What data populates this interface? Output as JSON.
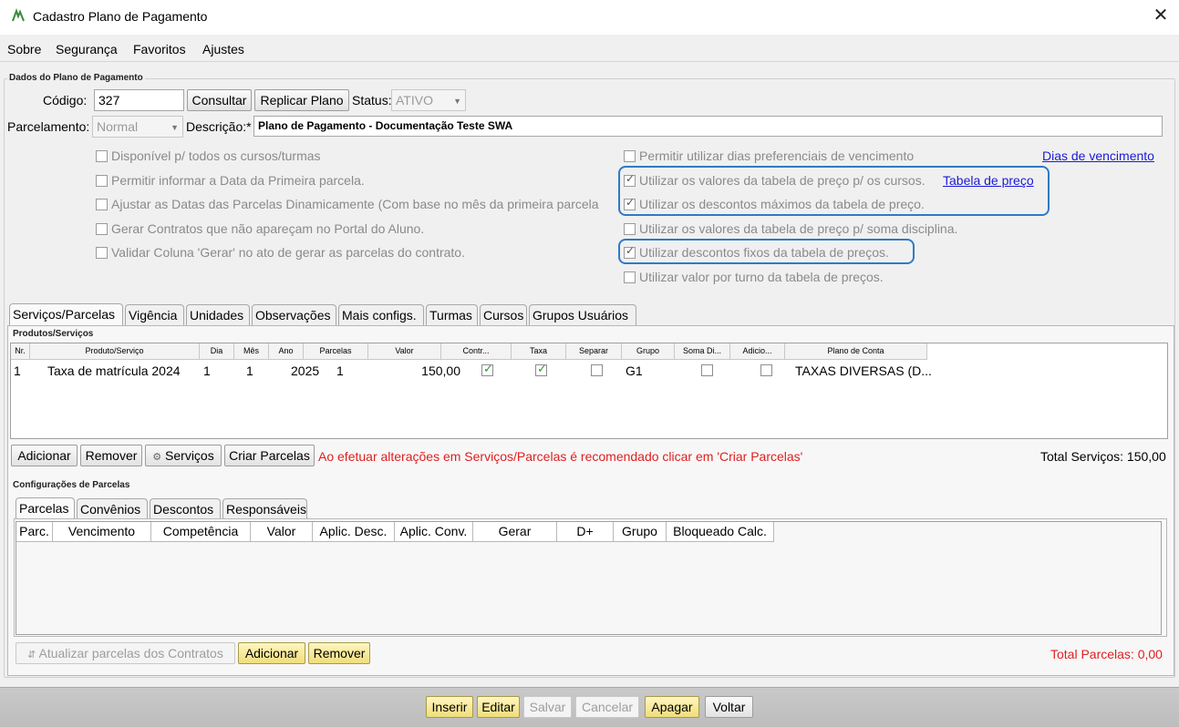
{
  "window": {
    "title": "Cadastro Plano de Pagamento"
  },
  "menu": {
    "items": [
      "Sobre",
      "Segurança",
      "Favoritos",
      "Ajustes"
    ]
  },
  "dados": {
    "legend": "Dados do Plano de Pagamento",
    "codigo_label": "Código:",
    "codigo_value": "327",
    "consultar_label": "Consultar",
    "replicar_label": "Replicar Plano",
    "status_label": "Status:",
    "status_value": "ATIVO",
    "parcelamento_label": "Parcelamento:",
    "parcelamento_value": "Normal",
    "descricao_label": "Descrição:*",
    "descricao_value": "Plano de Pagamento - Documentação Teste SWA"
  },
  "options_left": [
    {
      "label": "Disponível p/ todos os cursos/turmas",
      "checked": false
    },
    {
      "label": "Permitir informar a Data da Primeira parcela.",
      "checked": false
    },
    {
      "label": "Ajustar as Datas das Parcelas Dinamicamente (Com base no mês da primeira parcela",
      "checked": false
    },
    {
      "label": "Gerar Contratos que não apareçam no Portal do Aluno.",
      "checked": false
    },
    {
      "label": "Validar Coluna 'Gerar' no ato de gerar as parcelas do contrato.",
      "checked": false
    }
  ],
  "options_right": [
    {
      "label": "Permitir utilizar dias preferenciais de vencimento",
      "checked": false
    },
    {
      "label": "Utilizar os valores da tabela de preço p/ os cursos.",
      "checked": true
    },
    {
      "label": "Utilizar os descontos máximos da tabela de preço.",
      "checked": true
    },
    {
      "label": "Utilizar os valores da tabela de preço p/ soma disciplina.",
      "checked": false
    },
    {
      "label": "Utilizar descontos fixos da tabela de preços.",
      "checked": true
    },
    {
      "label": "Utilizar valor por turno da tabela de preços.",
      "checked": false
    }
  ],
  "links": {
    "dias": "Dias de vencimento",
    "tabela": "Tabela de preço"
  },
  "main_tabs": [
    "Serviços/Parcelas",
    "Vigência",
    "Unidades",
    "Observações",
    "Mais configs.",
    "Turmas",
    "Cursos",
    "Grupos Usuários"
  ],
  "produtos": {
    "legend": "Produtos/Serviços",
    "headers": [
      "Nr.",
      "Produto/Serviço",
      "Dia",
      "Mês",
      "Ano",
      "Parcelas",
      "Valor",
      "Contr...",
      "Taxa",
      "Separar",
      "Grupo",
      "Soma Di...",
      "Adicio...",
      "Plano de Conta"
    ],
    "row": {
      "nr": "1",
      "produto": "Taxa de matrícula 2024",
      "dia": "1",
      "mes": "1",
      "ano": "2025",
      "parcelas": "1",
      "valor": "150,00",
      "contr": true,
      "taxa": true,
      "separar": false,
      "grupo": "G1",
      "soma": false,
      "adicio": false,
      "plano": "TAXAS DIVERSAS (D..."
    },
    "btn_adicionar": "Adicionar",
    "btn_remover": "Remover",
    "btn_servicos": "Serviços",
    "btn_criar": "Criar Parcelas",
    "warning": "Ao efetuar alterações em Serviços/Parcelas é recomendado clicar em 'Criar Parcelas'",
    "total": "Total Serviços: 150,00"
  },
  "config": {
    "legend": "Configurações de Parcelas",
    "tabs": [
      "Parcelas",
      "Convênios",
      "Descontos",
      "Responsáveis"
    ],
    "headers": [
      "Parc.",
      "Vencimento",
      "Competência",
      "Valor",
      "Aplic. Desc.",
      "Aplic. Conv.",
      "Gerar",
      "D+",
      "Grupo",
      "Bloqueado Calc."
    ],
    "btn_atualizar": "Atualizar parcelas dos Contratos",
    "btn_adicionar": "Adicionar",
    "btn_remover": "Remover",
    "total": "Total Parcelas: 0,00"
  },
  "footer": {
    "inserir": "Inserir",
    "editar": "Editar",
    "salvar": "Salvar",
    "cancelar": "Cancelar",
    "apagar": "Apagar",
    "voltar": "Voltar"
  },
  "colors": {
    "accent_highlight": "#2f7ac5",
    "warning": "#e02020",
    "link": "#1a1ad6",
    "yellow_button": "#f0dd7a"
  },
  "icons": {
    "app": "app-logo-icon",
    "close": "close-icon",
    "servicos": "gears-icon",
    "atualizar": "refresh-icon"
  }
}
